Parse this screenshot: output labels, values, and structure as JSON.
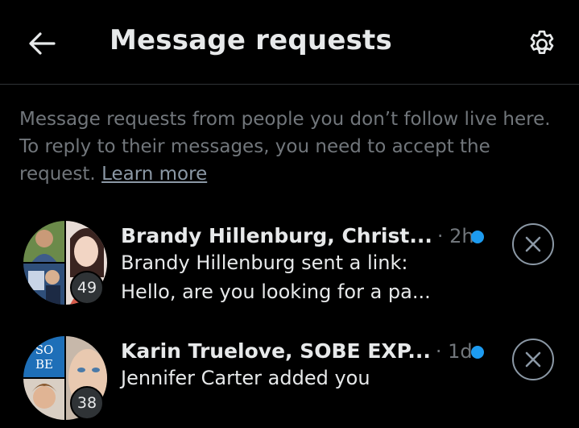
{
  "header": {
    "title": "Message requests",
    "back_icon": "arrow-left-icon",
    "settings_icon": "gear-icon"
  },
  "info": {
    "text": "Message requests from people you don’t follow live here. To reply to their messages, you need to accept the request.",
    "link_label": "Learn more"
  },
  "colors": {
    "accent": "#1d9bf0",
    "muted": "#71767b",
    "background": "#000000",
    "text": "#e7e9ea"
  },
  "requests": [
    {
      "names": "Brandy Hillenburg, Christ...",
      "time": "· 2h",
      "line1": "Brandy Hillenburg sent a link:",
      "line2": "Hello, are you looking for a pa...",
      "member_count": "49",
      "unread": true
    },
    {
      "names": "Karin Truelove, SOBE EXP...",
      "time": "· 1d",
      "line1": "Jennifer Carter added you",
      "avatar_text_1": "SO",
      "avatar_text_2": "BE",
      "member_count": "38",
      "unread": true
    }
  ]
}
